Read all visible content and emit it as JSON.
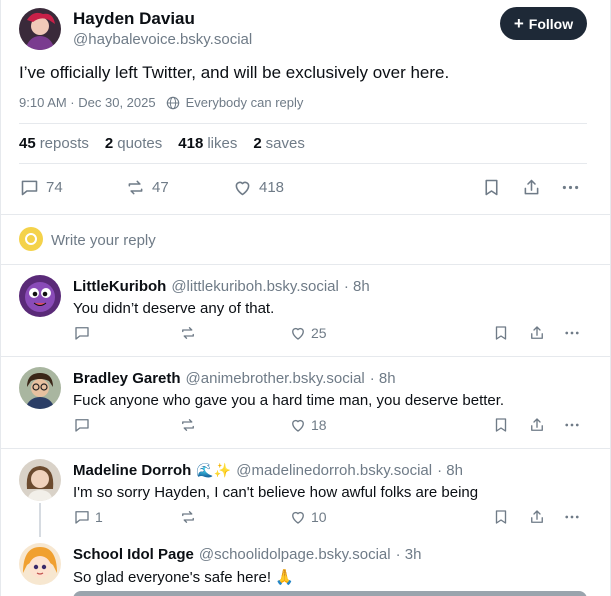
{
  "post": {
    "author_name": "Hayden Daviau",
    "author_handle": "@haybalevoice.bsky.social",
    "follow_label": "Follow",
    "text": "I’ve officially left Twitter, and will be exclusively over here.",
    "timestamp": "9:10 AM · Dec 30, 2025",
    "audience": "Everybody can reply",
    "stats": {
      "reposts_count": "45",
      "reposts_label": "reposts",
      "quotes_count": "2",
      "quotes_label": "quotes",
      "likes_count": "418",
      "likes_label": "likes",
      "saves_count": "2",
      "saves_label": "saves"
    },
    "actions": {
      "replies": "74",
      "reposts": "47",
      "likes": "418"
    }
  },
  "composer": {
    "placeholder": "Write your reply"
  },
  "replies": [
    {
      "name": "LittleKuriboh",
      "handle": "@littlekuriboh.bsky.social",
      "age": "· 8h",
      "text": "You didn’t deserve any of that.",
      "replies": "",
      "likes": "25",
      "avatar_icon": "purple-creature-avatar"
    },
    {
      "name": "Bradley Gareth",
      "handle": "@animebrother.bsky.social",
      "age": "· 8h",
      "text": "Fuck anyone who gave you a hard time man, you deserve better.",
      "replies": "",
      "likes": "18",
      "avatar_icon": "person-glasses-avatar"
    },
    {
      "name": "Madeline Dorroh",
      "emoji": "🌊✨",
      "handle": "@madelinedorroh.bsky.social",
      "age": "· 8h",
      "text": "I'm so sorry Hayden, I can't believe how awful folks are being",
      "replies": "1",
      "likes": "10",
      "avatar_icon": "person-avatar"
    },
    {
      "name": "School Idol Page",
      "handle": "@schoolidolpage.bsky.social",
      "age": "· 3h",
      "text": "So glad everyone's safe here! 🙏",
      "avatar_icon": "anime-avatar"
    }
  ],
  "colors": {
    "text": "#0b0f14",
    "muted": "#6f7b87",
    "follow_bg": "#1e2937",
    "divider": "#e6e9ed"
  }
}
